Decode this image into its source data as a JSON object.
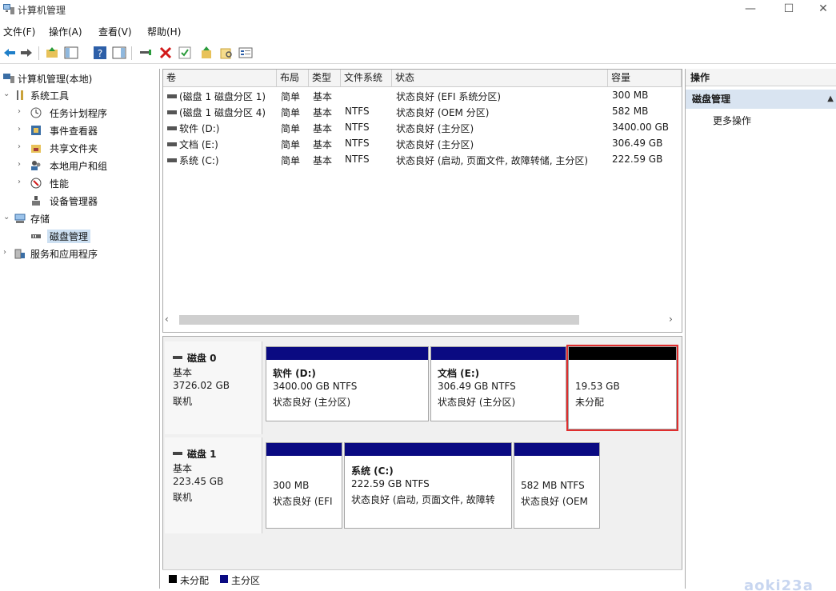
{
  "window": {
    "title": "计算机管理",
    "minimize": "—",
    "maximize": "☐",
    "close": "✕"
  },
  "menu": [
    "文件(F)",
    "操作(A)",
    "查看(V)",
    "帮助(H)"
  ],
  "tree": {
    "root": "计算机管理(本地)",
    "items": [
      {
        "label": "系统工具",
        "expander": "⌄",
        "icon": "tools-icon"
      },
      {
        "label": "任务计划程序",
        "expander": "›",
        "icon": "clock-icon"
      },
      {
        "label": "事件查看器",
        "expander": "›",
        "icon": "event-viewer-icon"
      },
      {
        "label": "共享文件夹",
        "expander": "›",
        "icon": "shared-folder-icon"
      },
      {
        "label": "本地用户和组",
        "expander": "›",
        "icon": "users-icon"
      },
      {
        "label": "性能",
        "expander": "›",
        "icon": "performance-icon"
      },
      {
        "label": "设备管理器",
        "expander": "",
        "icon": "device-manager-icon"
      },
      {
        "label": "存储",
        "expander": "⌄",
        "icon": "storage-icon"
      },
      {
        "label": "磁盘管理",
        "expander": "",
        "icon": "disk-management-icon"
      },
      {
        "label": "服务和应用程序",
        "expander": "›",
        "icon": "services-icon"
      }
    ]
  },
  "list": {
    "columns": [
      "卷",
      "布局",
      "类型",
      "文件系统",
      "状态",
      "容量"
    ],
    "rows": [
      {
        "volume": "(磁盘 1 磁盘分区 1)",
        "layout": "简单",
        "type": "基本",
        "fs": "",
        "status": "状态良好 (EFI 系统分区)",
        "capacity": "300 MB"
      },
      {
        "volume": "(磁盘 1 磁盘分区 4)",
        "layout": "简单",
        "type": "基本",
        "fs": "NTFS",
        "status": "状态良好 (OEM 分区)",
        "capacity": "582 MB"
      },
      {
        "volume": "软件 (D:)",
        "layout": "简单",
        "type": "基本",
        "fs": "NTFS",
        "status": "状态良好 (主分区)",
        "capacity": "3400.00 GB"
      },
      {
        "volume": "文档 (E:)",
        "layout": "简单",
        "type": "基本",
        "fs": "NTFS",
        "status": "状态良好 (主分区)",
        "capacity": "306.49 GB"
      },
      {
        "volume": "系统 (C:)",
        "layout": "简单",
        "type": "基本",
        "fs": "NTFS",
        "status": "状态良好 (启动, 页面文件, 故障转储, 主分区)",
        "capacity": "222.59 GB"
      }
    ],
    "scroll_left": "‹",
    "scroll_right": "›"
  },
  "disks": [
    {
      "name": "磁盘 0",
      "kind": "基本",
      "size": "3726.02 GB",
      "state": "联机",
      "partitions": [
        {
          "title": "软件  (D:)",
          "detail": "3400.00 GB NTFS",
          "status": "状态良好 (主分区)",
          "bar": "primary"
        },
        {
          "title": "文档  (E:)",
          "detail": "306.49 GB NTFS",
          "status": "状态良好 (主分区)",
          "bar": "primary"
        },
        {
          "title": "",
          "detail": "19.53 GB",
          "status": "未分配",
          "bar": "unallocated"
        }
      ]
    },
    {
      "name": "磁盘 1",
      "kind": "基本",
      "size": "223.45 GB",
      "state": "联机",
      "partitions": [
        {
          "title": "",
          "detail": "300 MB",
          "status": "状态良好 (EFI",
          "bar": "primary"
        },
        {
          "title": "系统  (C:)",
          "detail": "222.59 GB NTFS",
          "status": "状态良好 (启动, 页面文件, 故障转",
          "bar": "primary"
        },
        {
          "title": "",
          "detail": "582 MB NTFS",
          "status": "状态良好 (OEM",
          "bar": "primary"
        }
      ]
    }
  ],
  "legend": [
    {
      "label": "未分配",
      "color": "#000000"
    },
    {
      "label": "主分区",
      "color": "#0a0a82"
    }
  ],
  "actions": {
    "header": "操作",
    "section": "磁盘管理",
    "section_arrow": "▲",
    "item": "更多操作"
  },
  "watermark": "aoki23a",
  "colors": {
    "primary_bar": "#0a0a82",
    "unallocated_bar": "#000000",
    "highlight": "#e02e2e",
    "selection": "#cde0f2"
  }
}
